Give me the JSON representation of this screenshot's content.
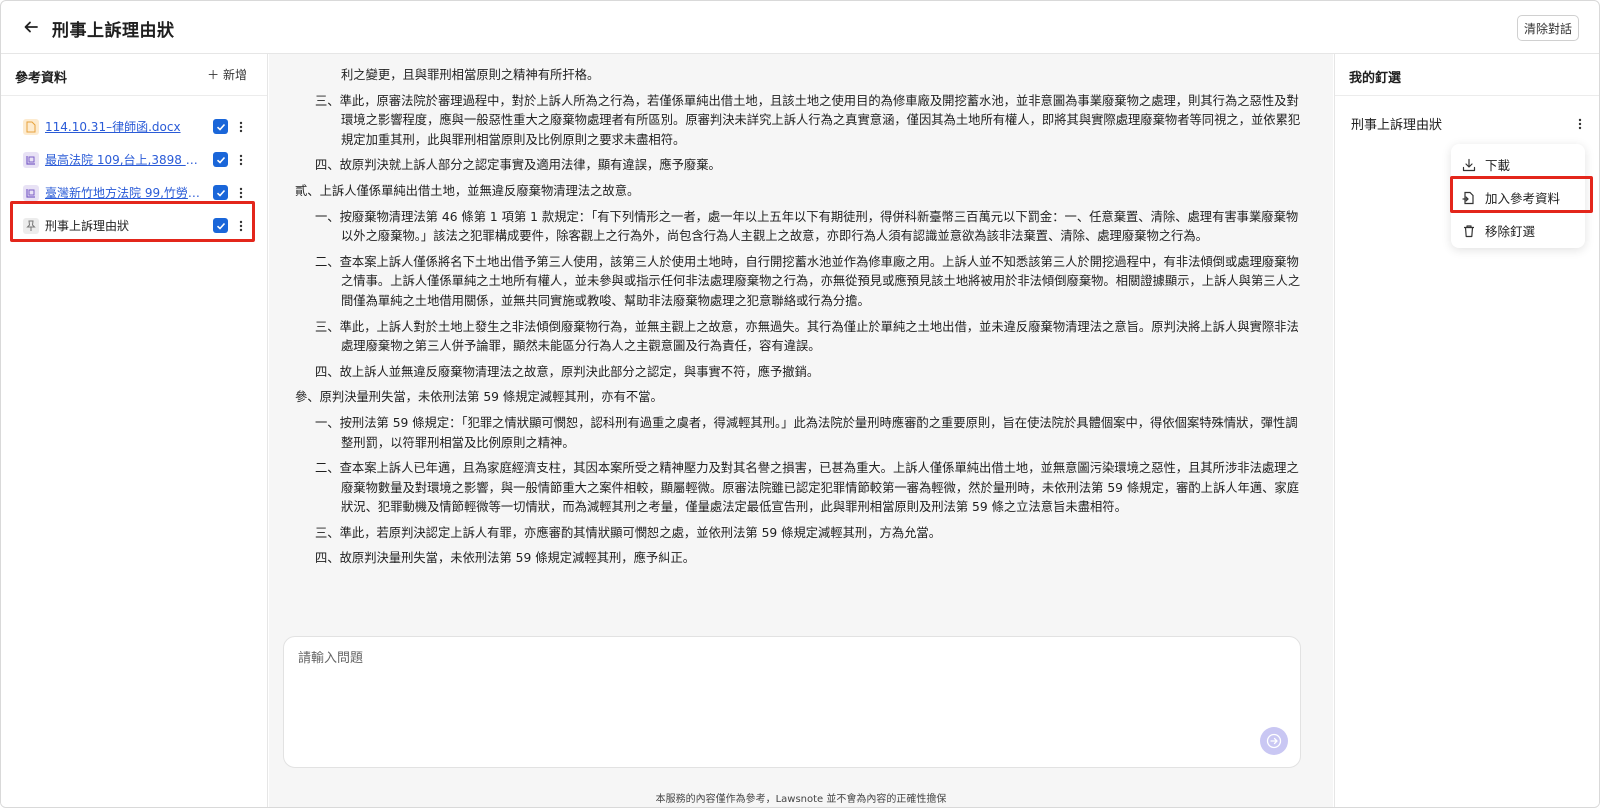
{
  "header": {
    "title": "刑事上訴理由狀",
    "clear_label": "清除對話"
  },
  "sidebar": {
    "title": "參考資料",
    "add_label": "＋ 新增",
    "items": [
      {
        "label": "114.10.31–律師函.docx",
        "type": "doc",
        "checked": true
      },
      {
        "label": "最高法院 109,台上,3898 建…",
        "type": "law",
        "checked": true
      },
      {
        "label": "臺灣新竹地方法院 99,竹勞簡…",
        "type": "law",
        "checked": true
      },
      {
        "label": "刑事上訴理由狀",
        "type": "pin",
        "checked": true
      }
    ]
  },
  "document": {
    "paragraphs": [
      {
        "level": 1,
        "text": "利之變更，且與罪刑相當原則之精神有所扞格。",
        "cont": true
      },
      {
        "level": 1,
        "text": "三、準此，原審法院於審理過程中，對於上訴人所為之行為，若僅係單純出借土地，且該土地之使用目的為修車廠及開挖蓄水池，並非意圖為事業廢棄物之處理，則其行為之惡性及對環境之影響程度，應與一般惡性重大之廢棄物處理者有所區別。原審判決未詳究上訴人行為之真實意涵，僅因其為土地所有權人，即將其與實際處理廢棄物者等同視之，並依累犯規定加重其刑，此與罪刑相當原則及比例原則之要求未盡相符。"
      },
      {
        "level": 1,
        "text": "四、故原判決就上訴人部分之認定事實及適用法律，顯有違誤，應予廢棄。"
      },
      {
        "level": 0,
        "text": "貳、上訴人僅係單純出借土地，並無違反廢棄物清理法之故意。"
      },
      {
        "level": 1,
        "text": "一、按廢棄物清理法第 46 條第 1 項第 1 款規定：「有下列情形之一者，處一年以上五年以下有期徒刑，得併科新臺幣三百萬元以下罰金：一、任意棄置、清除、處理有害事業廢棄物以外之廢棄物。」該法之犯罪構成要件，除客觀上之行為外，尚包含行為人主觀上之故意，亦即行為人須有認識並意欲為該非法棄置、清除、處理廢棄物之行為。"
      },
      {
        "level": 1,
        "text": "二、查本案上訴人僅係將名下土地出借予第三人使用，該第三人於使用土地時，自行開挖蓄水池並作為修車廠之用。上訴人並不知悉該第三人於開挖過程中，有非法傾倒或處理廢棄物之情事。上訴人僅係單純之土地所有權人，並未參與或指示任何非法處理廢棄物之行為，亦無從預見或應預見該土地將被用於非法傾倒廢棄物。相關證據顯示，上訴人與第三人之間僅為單純之土地借用關係，並無共同實施或教唆、幫助非法廢棄物處理之犯意聯絡或行為分擔。"
      },
      {
        "level": 1,
        "text": "三、準此，上訴人對於土地上發生之非法傾倒廢棄物行為，並無主觀上之故意，亦無過失。其行為僅止於單純之土地出借，並未違反廢棄物清理法之意旨。原判決將上訴人與實際非法處理廢棄物之第三人併予論罪，顯然未能區分行為人之主觀意圖及行為責任，容有違誤。"
      },
      {
        "level": 1,
        "text": "四、故上訴人並無違反廢棄物清理法之故意，原判決此部分之認定，與事實不符，應予撤銷。"
      },
      {
        "level": 0,
        "text": "參、原判決量刑失當，未依刑法第 59 條規定減輕其刑，亦有不當。"
      },
      {
        "level": 1,
        "text": "一、按刑法第 59 條規定：「犯罪之情狀顯可憫恕，認科刑有過重之虞者，得減輕其刑。」此為法院於量刑時應審酌之重要原則，旨在使法院於具體個案中，得依個案特殊情狀，彈性調整刑罰，以符罪刑相當及比例原則之精神。"
      },
      {
        "level": 1,
        "text": "二、查本案上訴人已年邁，且為家庭經濟支柱，其因本案所受之精神壓力及對其名譽之損害，已甚為重大。上訴人僅係單純出借土地，並無意圖污染環境之惡性，且其所涉非法處理之廢棄物數量及對環境之影響，與一般情節重大之案件相較，顯屬輕微。原審法院雖已認定犯罪情節較第一審為輕微，然於量刑時，未依刑法第 59 條規定，審酌上訴人年邁、家庭狀況、犯罪動機及情節輕微等一切情狀，而為減輕其刑之考量，僅量處法定最低宣告刑，此與罪刑相當原則及刑法第 59 條之立法意旨未盡相符。"
      },
      {
        "level": 1,
        "text": "三、準此，若原判決認定上訴人有罪，亦應審酌其情狀顯可憫恕之處，並依刑法第 59 條規定減輕其刑，方為允當。"
      },
      {
        "level": 1,
        "text": "四、故原判決量刑失當，未依刑法第 59 條規定減輕其刑，應予糾正。"
      }
    ]
  },
  "chat": {
    "placeholder": "請輸入問題",
    "disclaimer": "本服務的內容僅作為參考，Lawsnote 並不會為內容的正確性擔保"
  },
  "right_panel": {
    "title": "我的釘選",
    "pinned_item": "刑事上訴理由狀",
    "menu": [
      {
        "label": "下載",
        "icon": "download-icon"
      },
      {
        "label": "加入參考資料",
        "icon": "add-to-reference-icon"
      },
      {
        "label": "移除釘選",
        "icon": "trash-icon"
      }
    ]
  },
  "colors": {
    "checkbox": "#1a66d9",
    "highlight": "#e3261b",
    "send_button": "#c9c7f3",
    "link": "#2a5bd7"
  }
}
